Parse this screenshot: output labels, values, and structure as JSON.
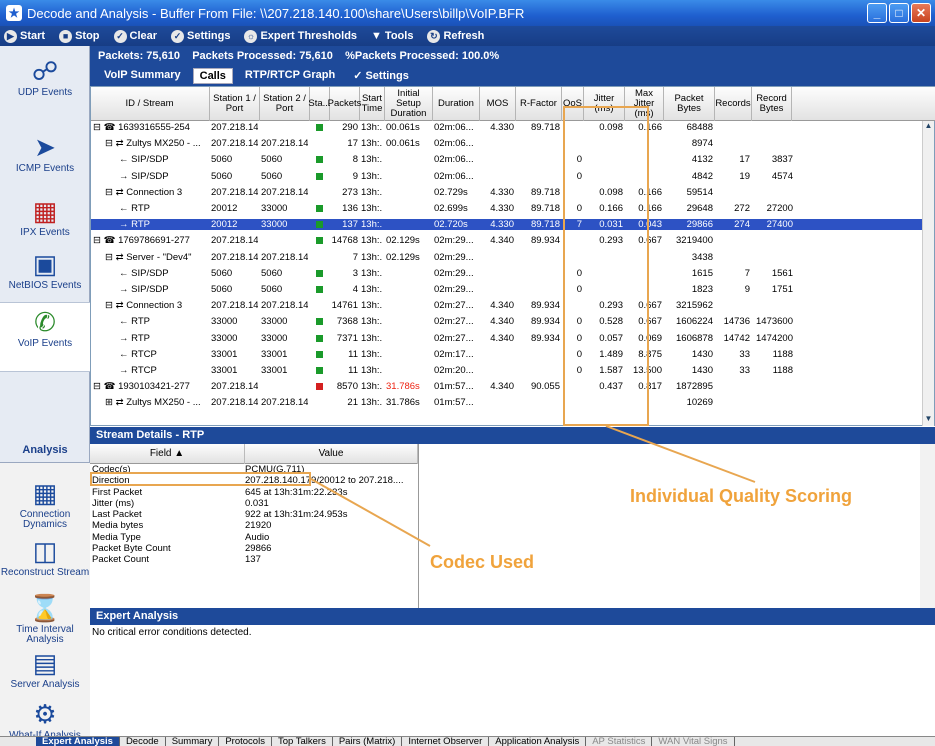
{
  "window": {
    "title": "Decode and Analysis - Buffer From File:  \\\\207.218.140.100\\share\\Users\\billp\\VoIP.BFR"
  },
  "toolbar": {
    "start": "Start",
    "stop": "Stop",
    "clear": "Clear",
    "settings": "Settings",
    "expert": "Expert Thresholds",
    "tools": "Tools",
    "refresh": "Refresh"
  },
  "nav": {
    "udp": "UDP Events",
    "icmp": "ICMP Events",
    "ipx": "IPX Events",
    "netbios": "NetBIOS Events",
    "voip": "VoIP Events",
    "analysis": "Analysis",
    "conn": "Connection Dynamics",
    "recon": "Reconstruct Stream",
    "time": "Time Interval Analysis",
    "server": "Server Analysis",
    "whatif": "What-If Analysis"
  },
  "info": {
    "packets": "Packets: 75,610",
    "processed": "Packets Processed: 75,610",
    "pct": "%Packets Processed: 100.0%"
  },
  "subtabs": [
    "VoIP Summary",
    "Calls",
    "RTP/RTCP Graph",
    "Settings"
  ],
  "columns": [
    "ID / Stream",
    "Station 1 / Port",
    "Station 2 / Port",
    "Sta...",
    "Packets",
    "Start Time",
    "Initial Setup Duration",
    "Duration",
    "MOS",
    "R-Factor",
    "QoS",
    "Jitter (ms)",
    "Max Jitter (ms)",
    "Packet Bytes",
    "Records",
    "Record Bytes"
  ],
  "rows": [
    [
      "1639316555-254",
      "207.218.14...",
      "",
      "g",
      "290",
      "13h:...",
      "00.061s",
      "02m:06...",
      "4.330",
      "89.718",
      "",
      "0.098",
      "0.166",
      "68488",
      "",
      ""
    ],
    [
      "Zultys MX250 - ...",
      "207.218.14...",
      "207.218.14...",
      "",
      "17",
      "13h:...",
      "00.061s",
      "02m:06...",
      "",
      "",
      "",
      "",
      "",
      "8974",
      "",
      ""
    ],
    [
      "← SIP/SDP",
      "5060",
      "5060",
      "g",
      "8",
      "13h:...",
      "",
      "02m:06...",
      "",
      "",
      "0",
      "",
      "",
      "4132",
      "17",
      "3837"
    ],
    [
      "→ SIP/SDP",
      "5060",
      "5060",
      "g",
      "9",
      "13h:...",
      "",
      "02m:06...",
      "",
      "",
      "0",
      "",
      "",
      "4842",
      "19",
      "4574"
    ],
    [
      "Connection 3",
      "207.218.14...",
      "207.218.14...",
      "",
      "273",
      "13h:...",
      "",
      "02.729s",
      "4.330",
      "89.718",
      "",
      "0.098",
      "0.166",
      "59514",
      "",
      ""
    ],
    [
      "← RTP",
      "20012",
      "33000",
      "g",
      "136",
      "13h:...",
      "",
      "02.699s",
      "4.330",
      "89.718",
      "0",
      "0.166",
      "0.166",
      "29648",
      "272",
      "27200"
    ],
    [
      "→ RTP",
      "20012",
      "33000",
      "g",
      "137",
      "13h:...",
      "",
      "02.720s",
      "4.330",
      "89.718",
      "7",
      "0.031",
      "0.043",
      "29866",
      "274",
      "27400"
    ],
    [
      "1769786691-277",
      "207.218.14...",
      "",
      "g",
      "14768",
      "13h:...",
      "02.129s",
      "02m:29...",
      "4.340",
      "89.934",
      "",
      "0.293",
      "0.667",
      "3219400",
      "",
      ""
    ],
    [
      "Server - \"Dev4\"",
      "207.218.14...",
      "207.218.14...",
      "",
      "7",
      "13h:...",
      "02.129s",
      "02m:29...",
      "",
      "",
      "",
      "",
      "",
      "3438",
      "",
      ""
    ],
    [
      "← SIP/SDP",
      "5060",
      "5060",
      "g",
      "3",
      "13h:...",
      "",
      "02m:29...",
      "",
      "",
      "0",
      "",
      "",
      "1615",
      "7",
      "1561"
    ],
    [
      "→ SIP/SDP",
      "5060",
      "5060",
      "g",
      "4",
      "13h:...",
      "",
      "02m:29...",
      "",
      "",
      "0",
      "",
      "",
      "1823",
      "9",
      "1751"
    ],
    [
      "Connection 3",
      "207.218.14...",
      "207.218.14...",
      "",
      "14761",
      "13h:...",
      "",
      "02m:27...",
      "4.340",
      "89.934",
      "",
      "0.293",
      "0.667",
      "3215962",
      "",
      ""
    ],
    [
      "← RTP",
      "33000",
      "33000",
      "g",
      "7368",
      "13h:...",
      "",
      "02m:27...",
      "4.340",
      "89.934",
      "0",
      "0.528",
      "0.667",
      "1606224",
      "14736",
      "1473600"
    ],
    [
      "→ RTP",
      "33000",
      "33000",
      "g",
      "7371",
      "13h:...",
      "",
      "02m:27...",
      "4.340",
      "89.934",
      "0",
      "0.057",
      "0.069",
      "1606878",
      "14742",
      "1474200"
    ],
    [
      "← RTCP",
      "33001",
      "33001",
      "g",
      "11",
      "13h:...",
      "",
      "02m:17...",
      "",
      "",
      "0",
      "1.489",
      "8.875",
      "1430",
      "33",
      "1188"
    ],
    [
      "→ RTCP",
      "33001",
      "33001",
      "g",
      "11",
      "13h:...",
      "",
      "02m:20...",
      "",
      "",
      "0",
      "1.587",
      "13.500",
      "1430",
      "33",
      "1188"
    ],
    [
      "1930103421-277",
      "207.218.14...",
      "",
      "r",
      "8570",
      "13h:...",
      "31.786s",
      "01m:57...",
      "4.340",
      "90.055",
      "",
      "0.437",
      "0.817",
      "1872895",
      "",
      ""
    ],
    [
      "Zultys MX250 - ...",
      "207.218.14...",
      "207.218.14...",
      "",
      "21",
      "13h:...",
      "31.786s",
      "01m:57...",
      "",
      "",
      "",
      "",
      "",
      "10269",
      "",
      ""
    ]
  ],
  "stream": {
    "title": "Stream Details - RTP",
    "field_col": "Field",
    "value_col": "Value",
    "rows": [
      [
        "Codec(s)",
        "PCMU(G.711)"
      ],
      [
        "Direction",
        "207.218.140.179/20012 to 207.218...."
      ],
      [
        "First Packet",
        "645 at 13h:31m:22.233s"
      ],
      [
        "Jitter (ms)",
        "0.031"
      ],
      [
        "Last Packet",
        "922 at 13h:31m:24.953s"
      ],
      [
        "Media bytes",
        "21920"
      ],
      [
        "Media Type",
        "Audio"
      ],
      [
        "Packet Byte Count",
        "29866"
      ],
      [
        "Packet Count",
        "137"
      ]
    ]
  },
  "expert": {
    "title": "Expert Analysis",
    "text": "No critical error conditions detected."
  },
  "bottom_tabs": [
    "Expert Analysis",
    "Decode",
    "Summary",
    "Protocols",
    "Top Talkers",
    "Pairs (Matrix)",
    "Internet Observer",
    "Application Analysis",
    "AP Statistics",
    "WAN Vital Signs"
  ],
  "callouts": {
    "quality": "Individual Quality Scoring",
    "codec": "Codec Used"
  },
  "colors": {
    "status_green": "#1a9a2a",
    "status_red": "#d42020",
    "title_blue": "#1f5fcf",
    "callout": "#f0a33c"
  }
}
